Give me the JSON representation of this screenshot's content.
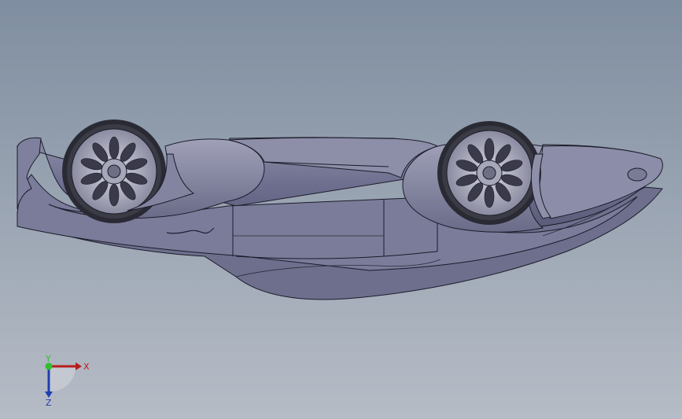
{
  "viewport": {
    "background_top": "#7f8ea0",
    "background_bottom": "#b6bcc6",
    "model": "car-body-upside-down"
  },
  "triad": {
    "x_label": "X",
    "y_label": "Y",
    "z_label": "Z",
    "x_color": "#b81c1c",
    "y_color": "#2fbf2f",
    "z_color": "#1f3fb0"
  }
}
